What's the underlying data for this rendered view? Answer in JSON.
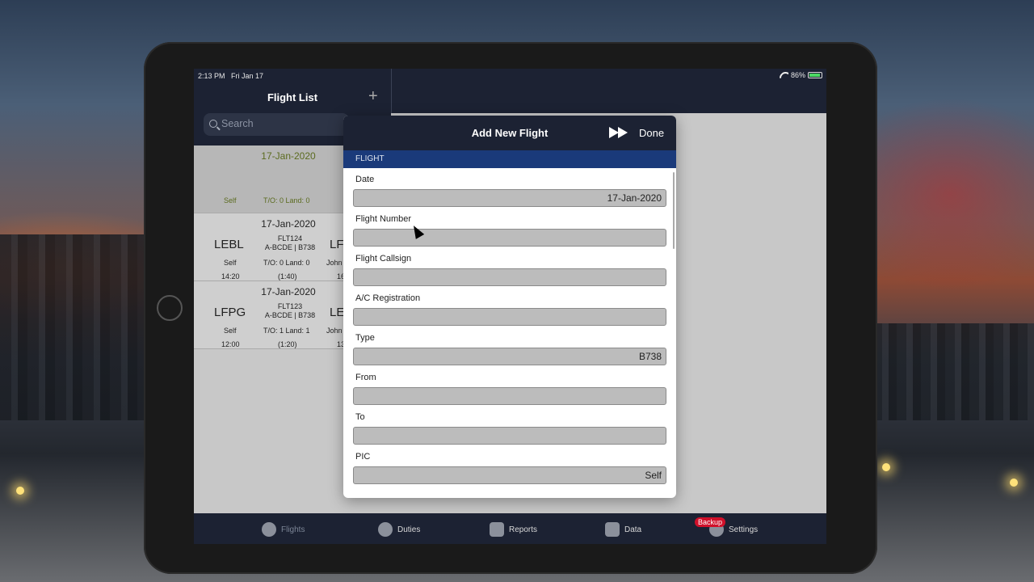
{
  "status": {
    "time": "2:13 PM",
    "date": "Fri Jan 17",
    "battery": "86%"
  },
  "flight_list": {
    "title": "Flight List",
    "search_placeholder": "Search",
    "rows": [
      {
        "date": "17-Jan-2020",
        "dep": "",
        "arr": "",
        "flight_no": "",
        "registration": "",
        "pic": "Self",
        "to": "T/O: 0   Land: 0",
        "pic2": "",
        "dep_time": "",
        "duration": "",
        "arr_time": ""
      },
      {
        "date": "17-Jan-2020",
        "dep": "LEBL",
        "arr": "LF",
        "flight_no": "FLT124",
        "registration": "A-BCDE | B738",
        "pic": "Self",
        "to": "T/O: 0   Land: 0",
        "pic2": "John",
        "dep_time": "14:20",
        "duration": "(1:40)",
        "arr_time": "16"
      },
      {
        "date": "17-Jan-2020",
        "dep": "LFPG",
        "arr": "LE",
        "flight_no": "FLT123",
        "registration": "A-BCDE | B738",
        "pic": "Self",
        "to": "T/O: 1   Land: 1",
        "pic2": "John",
        "dep_time": "12:00",
        "duration": "(1:20)",
        "arr_time": "13"
      }
    ]
  },
  "modal": {
    "title": "Add New Flight",
    "done_label": "Done",
    "section": "FLIGHT",
    "fields": [
      {
        "label": "Date",
        "value": "17-Jan-2020"
      },
      {
        "label": "Flight Number",
        "value": ""
      },
      {
        "label": "Flight Callsign",
        "value": ""
      },
      {
        "label": "A/C Registration",
        "value": ""
      },
      {
        "label": "Type",
        "value": "B738"
      },
      {
        "label": "From",
        "value": ""
      },
      {
        "label": "To",
        "value": ""
      },
      {
        "label": "PIC",
        "value": "Self"
      }
    ]
  },
  "tabbar": {
    "flights": "Flights",
    "duties": "Duties",
    "reports": "Reports",
    "data": "Data",
    "settings": "Settings",
    "settings_badge": "Backup"
  }
}
